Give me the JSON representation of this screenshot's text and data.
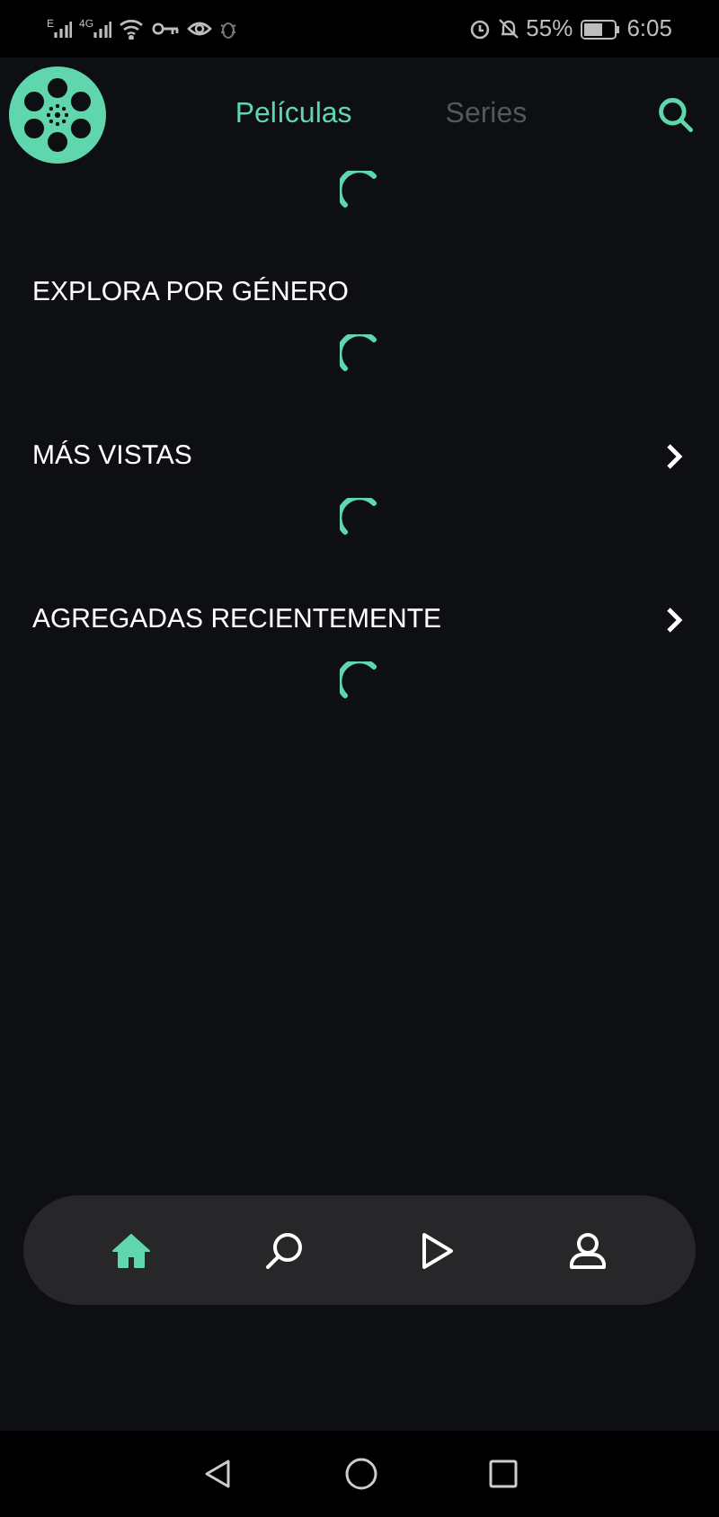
{
  "status_bar": {
    "network_labels": [
      "E",
      "4G"
    ],
    "battery": "55%",
    "time": "6:05"
  },
  "header": {
    "tabs": [
      {
        "label": "Películas",
        "selected": true
      },
      {
        "label": "Series",
        "selected": false
      }
    ]
  },
  "sections": [
    {
      "title": "EXPLORA POR GÉNERO",
      "has_more": false
    },
    {
      "title": "MÁS VISTAS",
      "has_more": true
    },
    {
      "title": "AGREGADAS RECIENTEMENTE",
      "has_more": true
    }
  ],
  "bottom_nav": [
    {
      "kind": "home",
      "selected": true
    },
    {
      "kind": "search",
      "selected": false
    },
    {
      "kind": "play",
      "selected": false
    },
    {
      "kind": "profile",
      "selected": false
    }
  ]
}
